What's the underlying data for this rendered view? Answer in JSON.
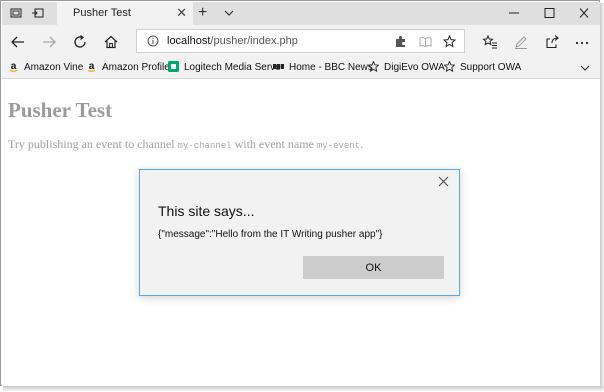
{
  "tab": {
    "title": "Pusher Test"
  },
  "address": {
    "host": "localhost",
    "path": "/pusher/index.php"
  },
  "favorites": [
    {
      "label": "Amazon Vine",
      "icon": "amazon-icon"
    },
    {
      "label": "Amazon Profile",
      "icon": "amazon-icon"
    },
    {
      "label": "Logitech Media Serve",
      "icon": "logitech-icon"
    },
    {
      "label": "Home - BBC News",
      "icon": "bbc-icon"
    },
    {
      "label": "DigiEvo OWA",
      "icon": "star-icon"
    },
    {
      "label": "Support OWA",
      "icon": "star-icon"
    }
  ],
  "page": {
    "heading": "Pusher Test",
    "intro_1": "Try publishing an event to channel ",
    "channel": "my-channel",
    "intro_2": " with event name ",
    "event": "my-event",
    "intro_3": "."
  },
  "dialog": {
    "title": "This site says...",
    "message": "{\"message\":\"Hello from the IT Writing pusher app\"}",
    "ok_label": "OK"
  },
  "colors": {
    "dialog_border": "#5aa9e6",
    "heading": "#9b9b9b",
    "ok_button": "#cccccc"
  }
}
